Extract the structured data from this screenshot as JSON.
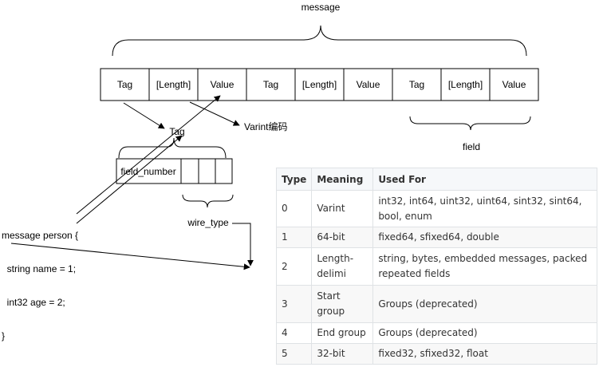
{
  "message_label": "message",
  "message_cells": [
    "Tag",
    "[Length]",
    "Value",
    "Tag",
    "[Length]",
    "Value",
    "Tag",
    "[Length]",
    "Value"
  ],
  "field_label": "field",
  "tag_label": "Tag",
  "varint_label": "Varint编码",
  "field_number_label": "field_number",
  "wire_type_label": "wire_type",
  "code_lines": [
    "message person {",
    "  string name = 1;",
    "  int32 age = 2;",
    "}"
  ],
  "table": {
    "headers": [
      "Type",
      "Meaning",
      "Used For"
    ],
    "rows": [
      {
        "type": "0",
        "meaning": "Varint",
        "used_for": "int32, int64, uint32, uint64, sint32, sint64, bool, enum"
      },
      {
        "type": "1",
        "meaning": "64-bit",
        "used_for": "fixed64, sfixed64, double"
      },
      {
        "type": "2",
        "meaning": "Length-delimi",
        "used_for": "string, bytes, embedded messages, packed repeated fields"
      },
      {
        "type": "3",
        "meaning": "Start group",
        "used_for": "Groups (deprecated)"
      },
      {
        "type": "4",
        "meaning": "End group",
        "used_for": "Groups (deprecated)"
      },
      {
        "type": "5",
        "meaning": "32-bit",
        "used_for": "fixed32, sfixed32, float"
      }
    ]
  }
}
